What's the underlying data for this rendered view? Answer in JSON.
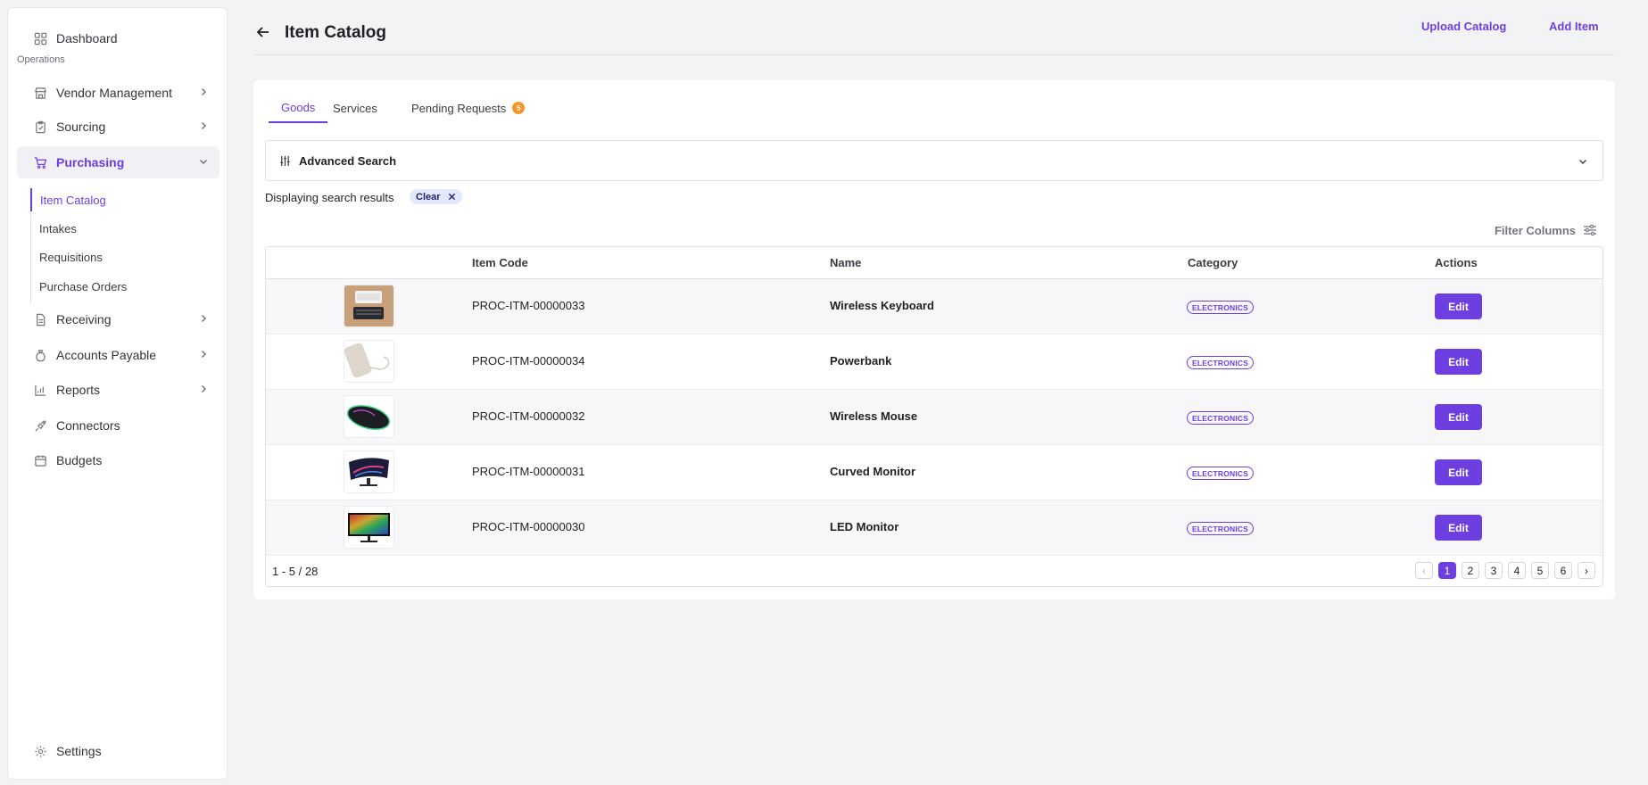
{
  "sidebar": {
    "dashboard": "Dashboard",
    "section_label": "Operations",
    "items": {
      "vendor": "Vendor Management",
      "sourcing": "Sourcing",
      "purchasing": "Purchasing",
      "receiving": "Receiving",
      "ap": "Accounts Payable",
      "reports": "Reports",
      "connectors": "Connectors",
      "budgets": "Budgets",
      "settings": "Settings"
    },
    "sub_items": [
      "Item Catalog",
      "Intakes",
      "Requisitions",
      "Purchase Orders"
    ]
  },
  "header": {
    "title": "Item Catalog",
    "upload_label": "Upload Catalog",
    "add_label": "Add Item"
  },
  "tabs": {
    "goods": "Goods",
    "services": "Services",
    "pending": "Pending Requests",
    "pending_count": "5"
  },
  "search": {
    "advanced_label": "Advanced Search",
    "results_text": "Displaying search results",
    "clear_label": "Clear",
    "filter_columns": "Filter Columns"
  },
  "table": {
    "columns": [
      "Item Code",
      "Name",
      "Category",
      "Actions"
    ],
    "rows": [
      {
        "code": "PROC-ITM-00000033",
        "name": "Wireless Keyboard",
        "category": "ELECTRONICS",
        "action": "Edit",
        "thumb": "keyboard"
      },
      {
        "code": "PROC-ITM-00000034",
        "name": "Powerbank",
        "category": "ELECTRONICS",
        "action": "Edit",
        "thumb": "powerbank"
      },
      {
        "code": "PROC-ITM-00000032",
        "name": "Wireless Mouse",
        "category": "ELECTRONICS",
        "action": "Edit",
        "thumb": "mouse"
      },
      {
        "code": "PROC-ITM-00000031",
        "name": "Curved Monitor",
        "category": "ELECTRONICS",
        "action": "Edit",
        "thumb": "curved-monitor"
      },
      {
        "code": "PROC-ITM-00000030",
        "name": "LED Monitor",
        "category": "ELECTRONICS",
        "action": "Edit",
        "thumb": "led-monitor"
      }
    ],
    "range_text": "1 - 5 / 28",
    "pagination": {
      "prev": "‹",
      "pages": [
        "1",
        "2",
        "3",
        "4",
        "5",
        "6"
      ],
      "next": "›",
      "current": "1"
    }
  },
  "colors": {
    "accent": "#6d3fe0",
    "badge": "#f7952a",
    "clear_chip_bg": "#e3e8fb"
  }
}
